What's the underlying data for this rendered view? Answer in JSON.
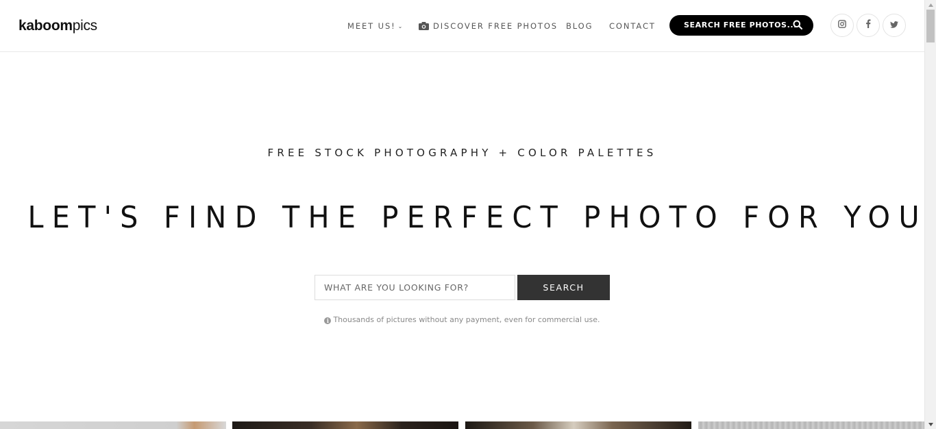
{
  "header": {
    "logo_bold": "kaboom",
    "logo_light": "pics",
    "nav": {
      "meet": "MEET US!",
      "discover": "DISCOVER FREE PHOTOS",
      "blog": "BLOG",
      "contact": "CONTACT"
    },
    "search_pill": "SEARCH FREE PHOTOS...",
    "social_icons": [
      "instagram-icon",
      "facebook-icon",
      "twitter-icon"
    ]
  },
  "hero": {
    "tagline": "FREE STOCK PHOTOGRAPHY + COLOR PALETTES",
    "headline": "LET'S FIND THE PERFECT PHOTO FOR YOU",
    "search_placeholder": "WHAT ARE YOU LOOKING FOR?",
    "search_button": "SEARCH",
    "note": "Thousands of pictures without any payment, even for commercial use."
  },
  "colors": {
    "accent": "#000000",
    "button": "#333333",
    "muted_text": "#888888"
  }
}
